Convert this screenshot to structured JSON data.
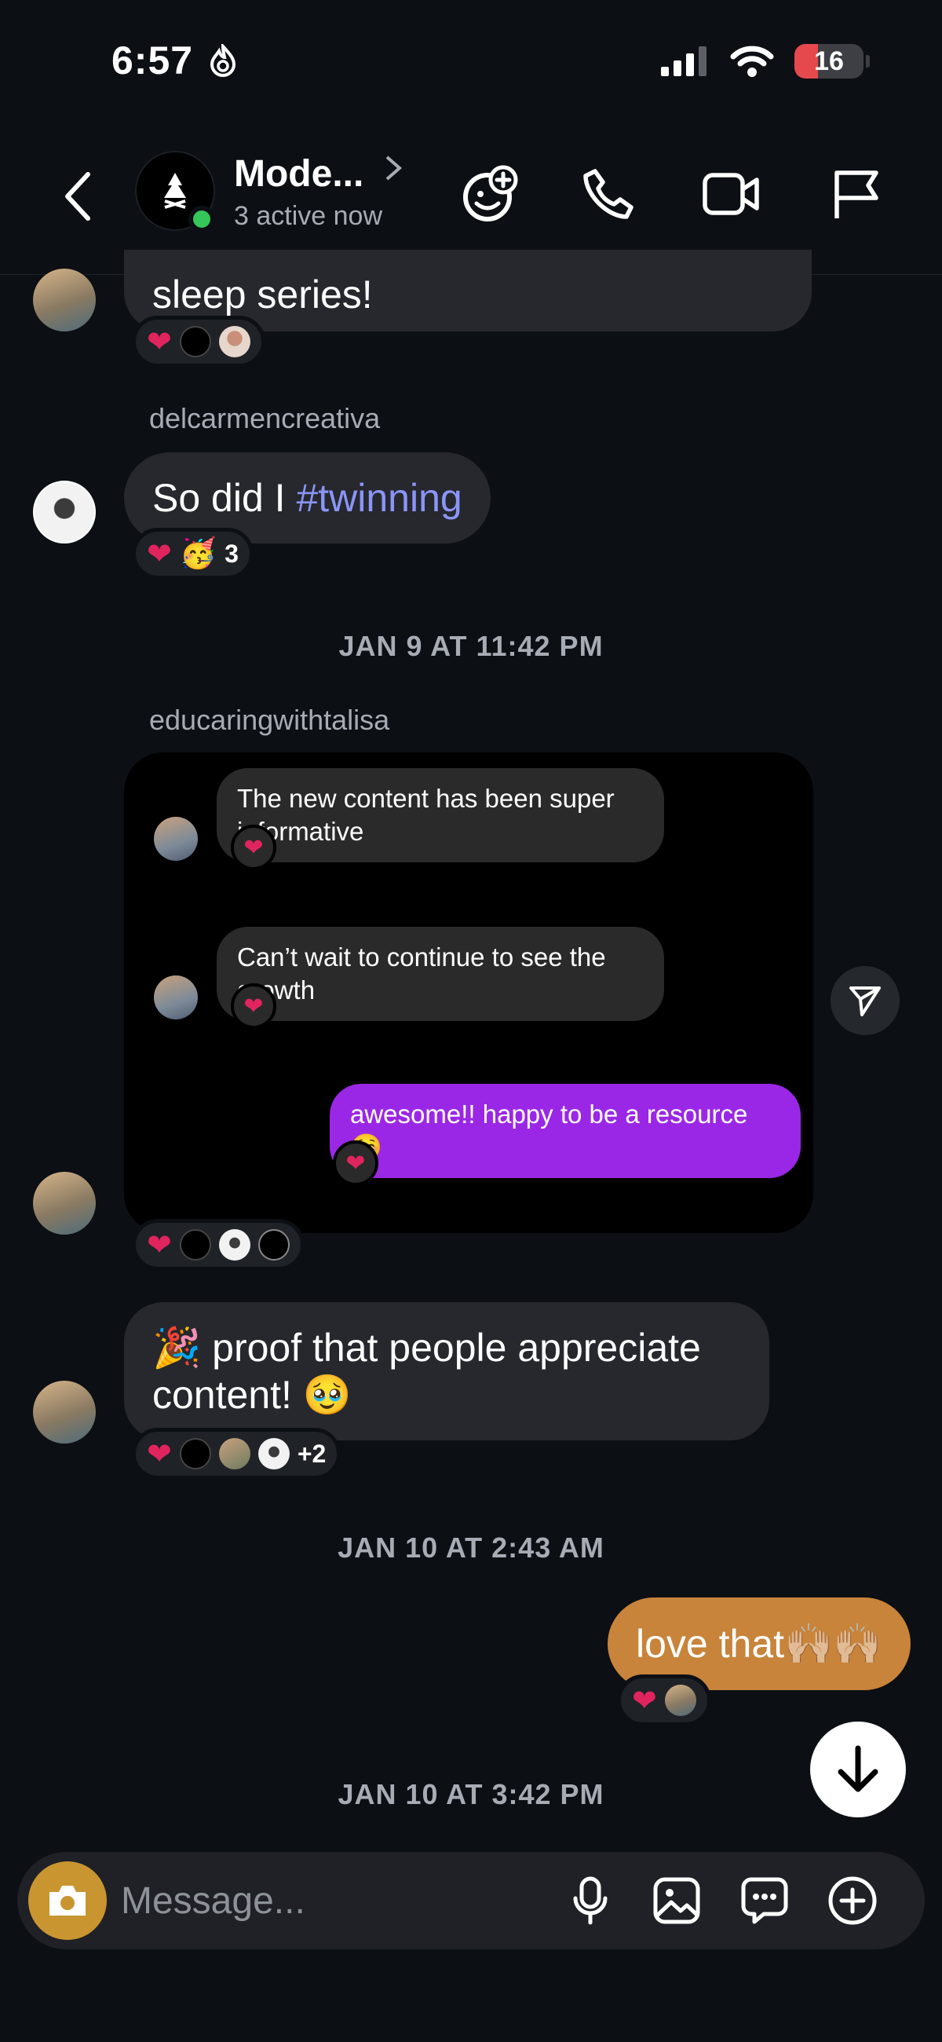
{
  "status_bar": {
    "time": "6:57",
    "battery": "16"
  },
  "header": {
    "title": "Mode...",
    "subtitle": "3 active now"
  },
  "messages": {
    "m1": {
      "text": "sleep series!"
    },
    "m2": {
      "username": "delcarmencreativa",
      "text_plain": "So did I ",
      "hashtag": "#twinning",
      "reaction_count": "3"
    },
    "date1": "JAN 9 AT 11:42 PM",
    "m3": {
      "username": "educaringwithtalisa",
      "shared": [
        {
          "text": "The new content has been super informative"
        },
        {
          "text": "Can’t wait to continue to see the growth"
        },
        {
          "text": "awesome!! happy to be a resource ☺️"
        }
      ]
    },
    "m4": {
      "text": "🎉 proof that people appreciate content! 🥹",
      "reaction_extra": "+2"
    },
    "date2": "JAN 10 AT 2:43 AM",
    "m5": {
      "text": "love that🙌🏼🙌🏼"
    },
    "date3": "JAN 10 AT 3:42 PM"
  },
  "composer": {
    "placeholder": "Message..."
  },
  "colors": {
    "accent_purple": "#9b27e6",
    "sent_bubble": "#c8843a",
    "hashtag": "#8b95f7",
    "camera": "#c99530",
    "online": "#35c759"
  },
  "icons": [
    "back-icon",
    "ai-sticker-icon",
    "phone-icon",
    "video-icon",
    "flag-icon",
    "mic-icon",
    "gallery-icon",
    "chat-icon",
    "plus-icon",
    "camera-icon",
    "send-icon",
    "arrow-down-icon"
  ]
}
